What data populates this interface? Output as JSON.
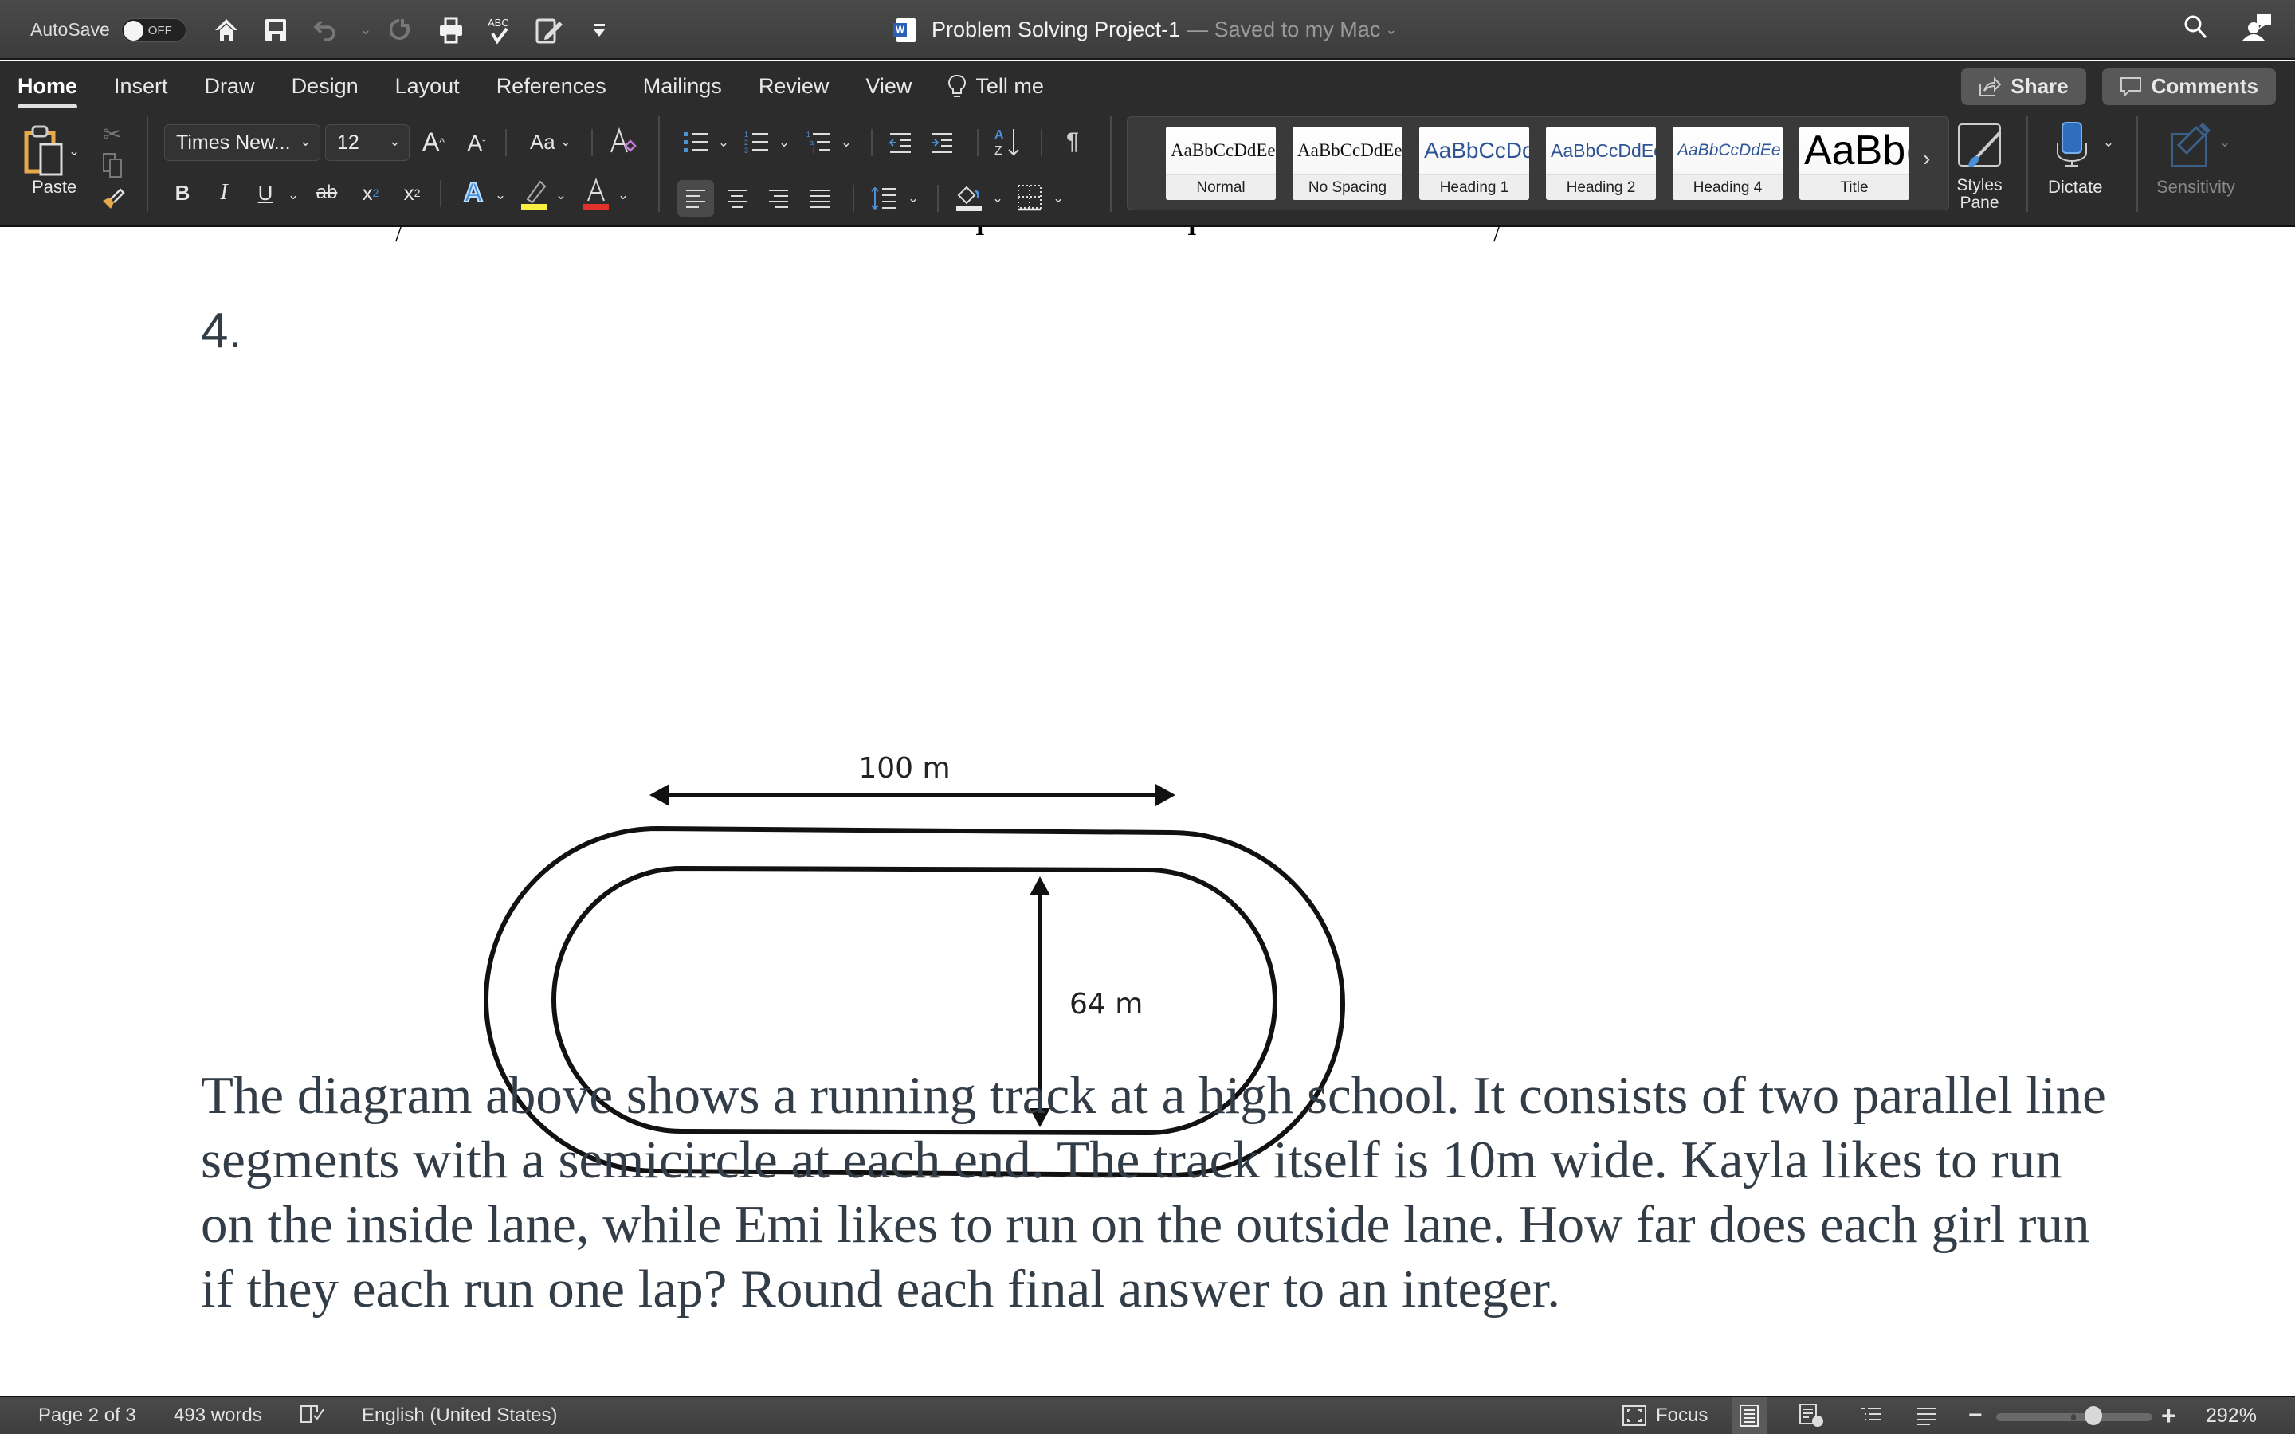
{
  "titlebar": {
    "autosave_label": "AutoSave",
    "autosave_state": "OFF",
    "quick_access": [
      "home-icon",
      "save-icon",
      "undo-icon",
      "redo-icon",
      "print-icon",
      "spelling-icon",
      "review-edit-icon",
      "customize-toolbar-icon"
    ],
    "doc_name": "Problem Solving Project-1",
    "save_status": "— Saved to my Mac"
  },
  "tabs": [
    {
      "label": "Home",
      "active": true
    },
    {
      "label": "Insert"
    },
    {
      "label": "Draw"
    },
    {
      "label": "Design"
    },
    {
      "label": "Layout"
    },
    {
      "label": "References"
    },
    {
      "label": "Mailings"
    },
    {
      "label": "Review"
    },
    {
      "label": "View"
    },
    {
      "label": "Tell me"
    }
  ],
  "actions": {
    "share": "Share",
    "comments": "Comments"
  },
  "ribbon": {
    "paste_label": "Paste",
    "font_name": "Times New...",
    "font_size": "12",
    "styles": [
      {
        "label": "Normal",
        "sample": "AaBbCcDdEe"
      },
      {
        "label": "No Spacing",
        "sample": "AaBbCcDdEe"
      },
      {
        "label": "Heading 1",
        "sample": "AaBbCcDc"
      },
      {
        "label": "Heading 2",
        "sample": "AaBbCcDdEe"
      },
      {
        "label": "Heading 4",
        "sample": "AaBbCcDdEe"
      },
      {
        "label": "Title",
        "sample": "AaBb("
      }
    ],
    "styles_pane_label": "Styles Pane",
    "dictate_label": "Dictate",
    "sensitivity_label": "Sensitivity",
    "colors": {
      "highlight": "#f7f040",
      "font_color": "#e0312a",
      "accent": "#4a90d9"
    }
  },
  "document": {
    "question_number": "4.",
    "diagram": {
      "straight_length_label": "100 m",
      "inner_width_label": "64 m"
    },
    "paragraph": "The diagram above shows a running track at a high school.  It consists of two parallel line\nsegments with a semicircle at each end.  The track itself is 10m wide.  Kayla likes to run\non the inside lane, while Emi likes to run on the outside lane.  How far does each girl run\nif they each run one lap?  Round each final answer to an integer."
  },
  "status": {
    "page": "Page 2 of 3",
    "words": "493 words",
    "language": "English (United States)",
    "focus": "Focus",
    "zoom": "292%",
    "zoom_fraction": 0.62
  }
}
